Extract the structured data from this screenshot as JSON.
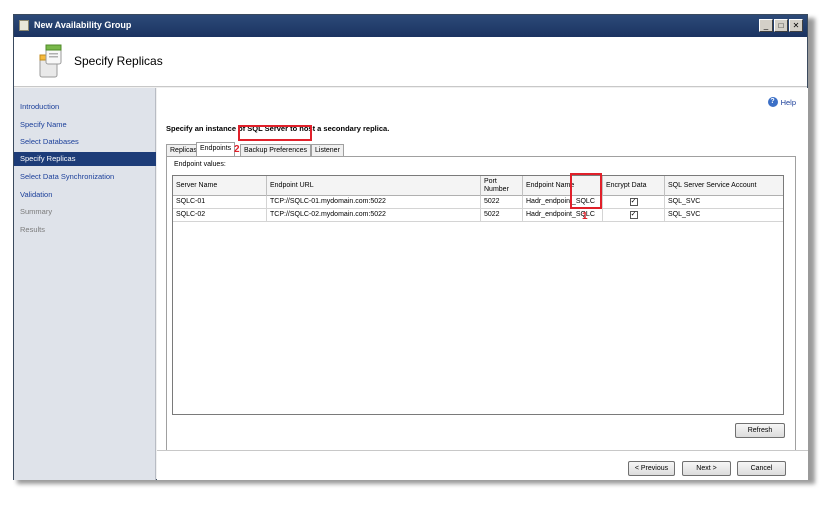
{
  "window": {
    "title": "New Availability Group",
    "controls": [
      "_",
      "□",
      "✕"
    ]
  },
  "header": {
    "heading": "Specify Replicas"
  },
  "sidebar": {
    "items": [
      {
        "label": "Introduction",
        "state": "normal"
      },
      {
        "label": "Specify Name",
        "state": "normal"
      },
      {
        "label": "Select Databases",
        "state": "normal"
      },
      {
        "label": "Specify Replicas",
        "state": "selected"
      },
      {
        "label": "Select Data Synchronization",
        "state": "normal"
      },
      {
        "label": "Validation",
        "state": "normal"
      },
      {
        "label": "Summary",
        "state": "disabled"
      },
      {
        "label": "Results",
        "state": "disabled"
      }
    ]
  },
  "help": {
    "label": "Help",
    "icon": "help-icon"
  },
  "main": {
    "instruction": "Specify an instance of SQL Server to host a secondary replica.",
    "tabs": [
      {
        "label": "Replicas",
        "active": false
      },
      {
        "label": "Endpoints",
        "active": true
      },
      {
        "label": "Backup Preferences",
        "active": false
      },
      {
        "label": "Listener",
        "active": false
      }
    ],
    "endpoint_values_label": "Endpoint values:",
    "table": {
      "columns": [
        "Server Name",
        "Endpoint URL",
        "Port Number",
        "Endpoint Name",
        "Encrypt Data",
        "SQL Server Service Account"
      ],
      "rows": [
        {
          "server": "SQLC-01",
          "url": "TCP://SQLC-01.mydomain.com:5022",
          "port": "5022",
          "endpoint": "Hadr_endpoint_SQLC",
          "encrypt": true,
          "account": "SQL_SVC"
        },
        {
          "server": "SQLC-02",
          "url": "TCP://SQLC-02.mydomain.com:5022",
          "port": "5022",
          "endpoint": "Hadr_endpoint_SQLC",
          "encrypt": true,
          "account": "SQL_SVC"
        }
      ]
    },
    "refresh_label": "Refresh"
  },
  "footer": {
    "previous_label": "< Previous",
    "next_label": "Next >",
    "cancel_label": "Cancel"
  },
  "annotations": {
    "marker_1": "1",
    "marker_2": "2",
    "color": "#e0202a"
  },
  "colors": {
    "titlebar": "#1b3361",
    "selected_nav": "#1d3c78",
    "link": "#1b3f9a"
  }
}
